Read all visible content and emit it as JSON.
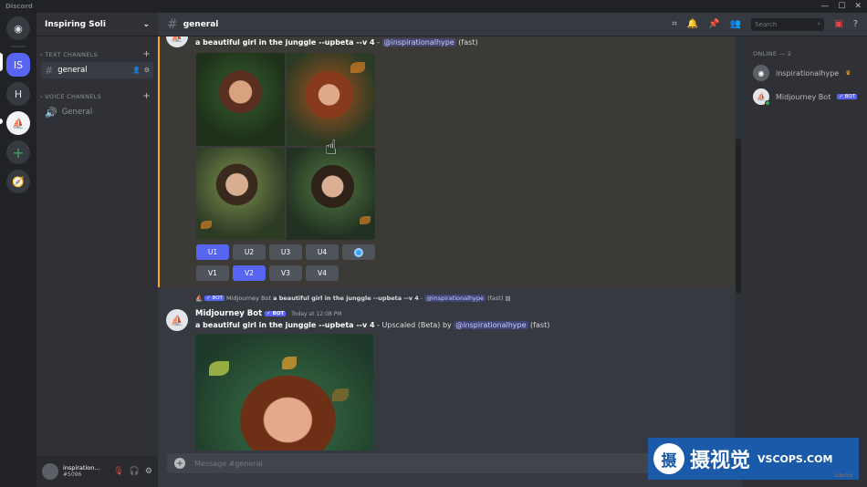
{
  "window": {
    "app_name": "Discord",
    "minimize": "—",
    "maximize": "☐",
    "close": "✕"
  },
  "servers": [
    {
      "id": "home",
      "label": "◉"
    },
    {
      "id": "IS",
      "label": "IS"
    },
    {
      "id": "H",
      "label": "H"
    },
    {
      "id": "sail",
      "label": "⛵"
    },
    {
      "id": "add",
      "label": "+"
    },
    {
      "id": "explore",
      "label": "🧭"
    }
  ],
  "guild": {
    "name": "Inspiring Soli",
    "chevron": "⌄"
  },
  "categories": {
    "text": "TEXT CHANNELS",
    "voice": "VOICE CHANNELS"
  },
  "text_channels": [
    {
      "name": "general"
    }
  ],
  "voice_channels": [
    {
      "name": "General"
    }
  ],
  "user": {
    "name": "inspiration...",
    "tag": "#5096"
  },
  "header": {
    "channel": "general",
    "search_placeholder": "Search"
  },
  "message1": {
    "prompt": "a beautiful girl in the junggle --upbeta --v 4",
    "sep": " - ",
    "mention": "@inspirationalhype",
    "suffix": " (fast)",
    "row1": [
      "U1",
      "U2",
      "U3",
      "U4"
    ],
    "row2": [
      "V1",
      "V2",
      "V3",
      "V4"
    ],
    "active_u": "U1",
    "active_v": "V2"
  },
  "message2": {
    "reply_bot_tag": "✓ BOT",
    "reply_author": "Midjourney Bot",
    "reply_prompt": "a beautiful girl in the junggle --upbeta --v 4",
    "reply_sep": " - ",
    "reply_mention": "@inspirationalhype",
    "reply_suffix": " (fast)",
    "author": "Midjourney Bot",
    "bot_tag": "✓ BOT",
    "timestamp": "Today at 12:08 PM",
    "prompt": "a beautiful girl in the junggle --upbeta --v 4",
    "upscaled": " - Upscaled (Beta) by ",
    "mention": "@inspirationalhype",
    "suffix": " (fast)"
  },
  "composer": {
    "placeholder": "Message #general"
  },
  "members": {
    "heading": "ONLINE — 2",
    "list": [
      {
        "name": "inspirationalhype",
        "badge": "♛"
      },
      {
        "name": "Midjourney Bot",
        "badge": "✓ BOT"
      }
    ]
  },
  "watermark": {
    "cn": "摄视觉",
    "en": "VSCOPS.COM",
    "logo": "摄",
    "sub": "udemy"
  },
  "colors": {
    "accent": "#5865f2",
    "online": "#3ba55c",
    "highlight": "#faa81a"
  }
}
